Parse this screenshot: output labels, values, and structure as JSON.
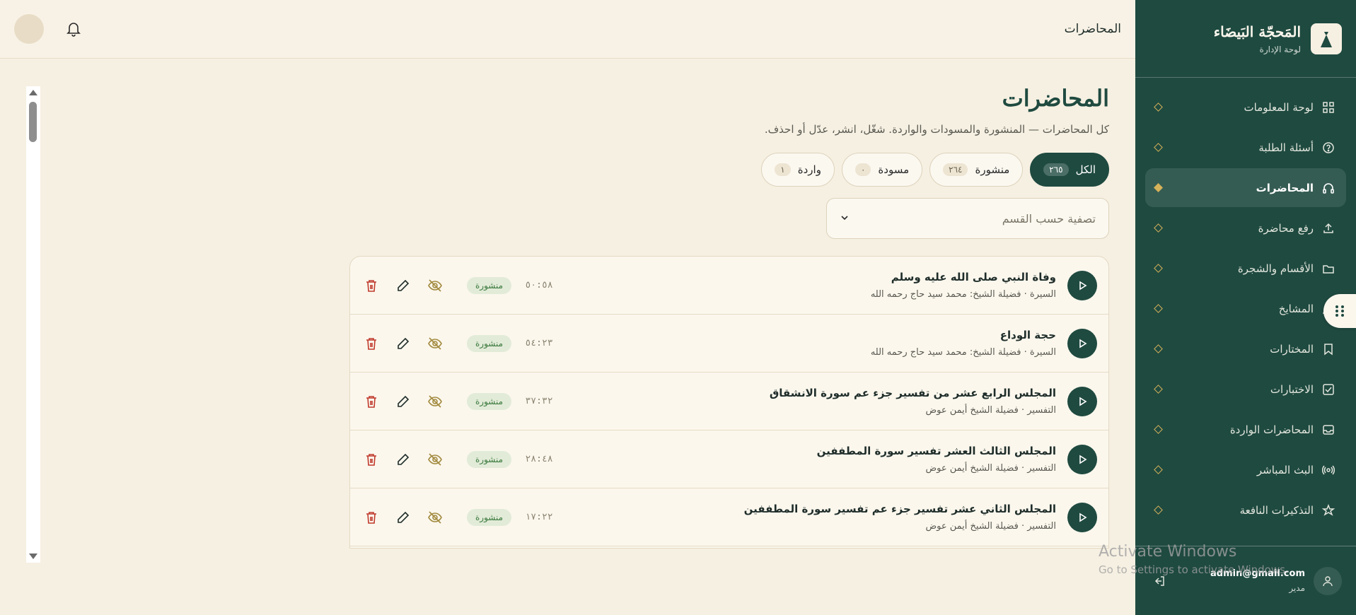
{
  "topbar": {
    "title": "المحاضرات"
  },
  "sidebar": {
    "brand_title": "المَحجّة البَيضَاء",
    "brand_sub": "لوحة الإدارة",
    "items": [
      {
        "label": "لوحة المعلومات",
        "icon": "grid-icon"
      },
      {
        "label": "أسئلة الطلبة",
        "icon": "question-circle-icon"
      },
      {
        "label": "المحاضرات",
        "icon": "headphones-icon",
        "active": true
      },
      {
        "label": "رفع محاضرة",
        "icon": "upload-icon"
      },
      {
        "label": "الأقسام والشجرة",
        "icon": "folder-icon"
      },
      {
        "label": "المشايخ",
        "icon": "users-icon"
      },
      {
        "label": "المختارات",
        "icon": "bookmark-icon"
      },
      {
        "label": "الاختبارات",
        "icon": "check-square-icon"
      },
      {
        "label": "المحاضرات الواردة",
        "icon": "inbox-icon"
      },
      {
        "label": "البث المباشر",
        "icon": "broadcast-icon"
      },
      {
        "label": "التذكيرات النافعة",
        "icon": "star-icon"
      }
    ],
    "user_email": "admin@gmail.com",
    "user_role": "مدير"
  },
  "main": {
    "title": "المحاضرات",
    "subtitle": "كل المحاضرات — المنشورة والمسودات والواردة. شغّل، انشر، عدّل أو احذف.",
    "filters": [
      {
        "label": "الكل",
        "count": "٢٦٥"
      },
      {
        "label": "منشورة",
        "count": "٢٦٤"
      },
      {
        "label": "مسودة",
        "count": "٠"
      },
      {
        "label": "واردة",
        "count": "١"
      }
    ],
    "category_placeholder": "تصفية حسب القسم",
    "lectures": [
      {
        "title": "وفاة النبي صلى الله عليه وسلم",
        "meta": "السيرة · فضيلة الشيخ: محمد سيد حاج رحمه الله",
        "duration": "٥٠:٥٨",
        "status": "منشورة"
      },
      {
        "title": "حجة الوداع",
        "meta": "السيرة · فضيلة الشيخ: محمد سيد حاج رحمه الله",
        "duration": "٥٤:٢٣",
        "status": "منشورة"
      },
      {
        "title": "المجلس الرابع عشر من تفسير جزء عم سورة الانشقاق",
        "meta": "التفسير · فضيلة الشيخ أيمن عوض",
        "duration": "٣٧:٣٢",
        "status": "منشورة"
      },
      {
        "title": "المجلس الثالث العشر تفسير سورة المطففين",
        "meta": "التفسير · فضيلة الشيخ أيمن عوض",
        "duration": "٢٨:٤٨",
        "status": "منشورة"
      },
      {
        "title": "المجلس الثاني عشر تفسير جزء عم تفسير سورة المطففين",
        "meta": "التفسير · فضيلة الشيخ أيمن عوض",
        "duration": "١٧:٢٢",
        "status": "منشورة"
      }
    ]
  },
  "watermark": {
    "line1": "Activate Windows",
    "line2": "Go to Settings to activate Windows."
  },
  "colors": {
    "sidebar_bg": "#1f4a40",
    "accent_gold": "#d6b25a",
    "page_bg": "#f6f0e2",
    "delete_red": "#c0392b",
    "status_green": "#3b7a3e"
  }
}
